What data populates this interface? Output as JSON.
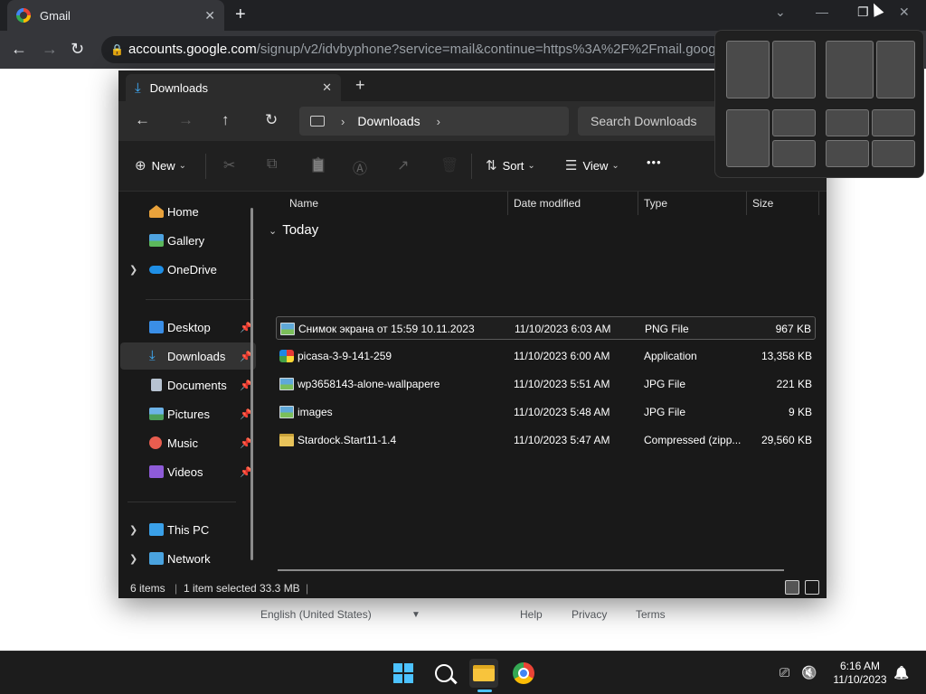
{
  "chrome": {
    "tab_title": "Gmail",
    "tab_close": "✕",
    "new_tab": "+",
    "url_host": "accounts.google.com",
    "url_path": "/signup/v2/idvbyphone?service=mail&continue=https%3A%2F%2Fmail.google.c...",
    "back": "←",
    "forward": "→",
    "reload": "↻",
    "win_dropdown": "⌄",
    "win_minimize": "—",
    "win_restore": "❐",
    "win_close": "✕"
  },
  "google_footer": {
    "language": "English (United States)",
    "language_caret": "▼",
    "help": "Help",
    "privacy": "Privacy",
    "terms": "Terms"
  },
  "explorer": {
    "tab_title": "Downloads",
    "tab_close": "✕",
    "new_tab": "+",
    "breadcrumb": [
      "Downloads"
    ],
    "breadcrumb_chevron": "›",
    "search_placeholder": "Search Downloads",
    "nav": {
      "back": "←",
      "forward": "→",
      "up": "↑",
      "refresh": "↻"
    },
    "commands": {
      "new_label": "New",
      "new_icon": "⊕",
      "sort_label": "Sort",
      "sort_icon": "⇅",
      "view_label": "View",
      "view_icon": "☰",
      "caret": "⌄",
      "more": "•••",
      "cut": "✂",
      "copy": "⧉",
      "paste": "📋",
      "rename": "Ⓐ",
      "share": "↗",
      "delete": "🗑"
    },
    "sidebar": [
      {
        "label": "Home",
        "pinned": false,
        "expandable": false
      },
      {
        "label": "Gallery",
        "pinned": false,
        "expandable": false
      },
      {
        "label": "OneDrive",
        "pinned": false,
        "expandable": true
      },
      {
        "label": "Desktop",
        "pinned": true,
        "expandable": false
      },
      {
        "label": "Downloads",
        "pinned": true,
        "expandable": false,
        "selected": true
      },
      {
        "label": "Documents",
        "pinned": true,
        "expandable": false
      },
      {
        "label": "Pictures",
        "pinned": true,
        "expandable": false
      },
      {
        "label": "Music",
        "pinned": true,
        "expandable": false
      },
      {
        "label": "Videos",
        "pinned": true,
        "expandable": false
      },
      {
        "label": "This PC",
        "pinned": false,
        "expandable": true
      },
      {
        "label": "Network",
        "pinned": false,
        "expandable": true
      }
    ],
    "sidebar_pin": "📌",
    "sidebar_expand": "❯",
    "columns": [
      "Name",
      "Date modified",
      "Type",
      "Size"
    ],
    "group_label": "Today",
    "group_chevron": "⌄",
    "files": [
      {
        "name": "Снимок экрана от 15:59  10.11.2023",
        "date": "11/10/2023 6:03 AM",
        "type": "PNG File",
        "size": "967 KB",
        "icon": "image-file-icon",
        "selected": true
      },
      {
        "name": "picasa-3-9-141-259",
        "date": "11/10/2023 6:00 AM",
        "type": "Application",
        "size": "13,358 KB",
        "icon": "application-icon",
        "selected": false
      },
      {
        "name": "wp3658143-alone-wallpapere",
        "date": "11/10/2023 5:51 AM",
        "type": "JPG File",
        "size": "221 KB",
        "icon": "image-file-icon",
        "selected": false
      },
      {
        "name": "images",
        "date": "11/10/2023 5:48 AM",
        "type": "JPG File",
        "size": "9 KB",
        "icon": "image-file-icon",
        "selected": false
      },
      {
        "name": "Stardock.Start11-1.4",
        "date": "11/10/2023 5:47 AM",
        "type": "Compressed (zipp...",
        "size": "29,560 KB",
        "icon": "zip-folder-icon",
        "selected": false
      }
    ],
    "status": {
      "count": "6 items",
      "selected": "1 item selected",
      "size": "33.3 MB",
      "divider": "|"
    }
  },
  "taskbar": {
    "time": "6:16 AM",
    "date": "11/10/2023",
    "tray_display": "⎚",
    "tray_volume": "🔇",
    "tray_bell": "🔔"
  },
  "colors": {
    "accent": "#4cc2ff",
    "explorer_bg": "#191919",
    "chrome_bg": "#202124"
  }
}
